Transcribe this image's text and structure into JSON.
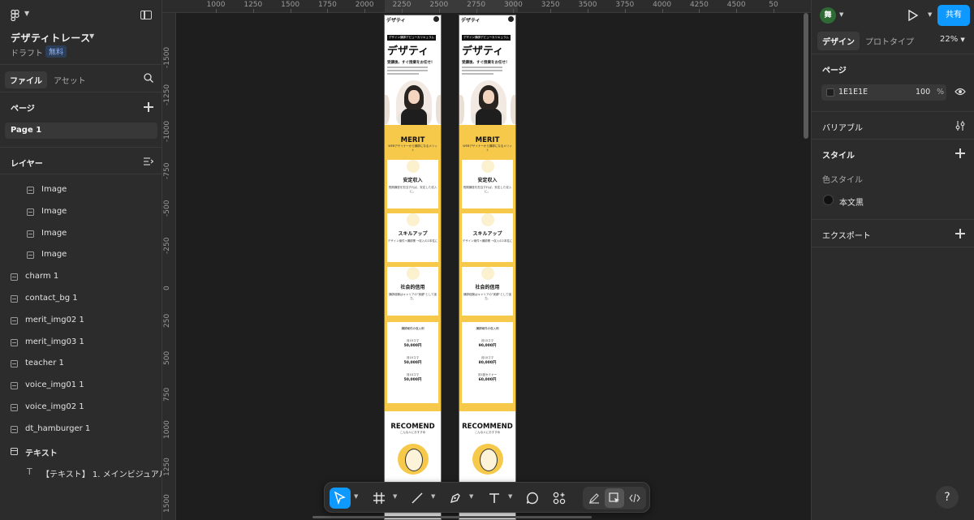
{
  "file": {
    "title": "デザティトレース",
    "draft_label": "ドラフト",
    "plan_badge": "無料"
  },
  "left_tabs": {
    "file": "ファイル",
    "assets": "アセット"
  },
  "pages": {
    "title": "ページ",
    "items": [
      "Page 1"
    ]
  },
  "layers": {
    "title": "レイヤー",
    "items": [
      {
        "name": "Image",
        "type": "image",
        "indent": 1
      },
      {
        "name": "Image",
        "type": "image",
        "indent": 1
      },
      {
        "name": "Image",
        "type": "image",
        "indent": 1
      },
      {
        "name": "Image",
        "type": "image",
        "indent": 1
      },
      {
        "name": "charm 1",
        "type": "image",
        "indent": 0
      },
      {
        "name": "contact_bg 1",
        "type": "image",
        "indent": 0
      },
      {
        "name": "merit_img02 1",
        "type": "image",
        "indent": 0
      },
      {
        "name": "merit_img03 1",
        "type": "image",
        "indent": 0
      },
      {
        "name": "teacher 1",
        "type": "image",
        "indent": 0
      },
      {
        "name": "voice_img01 1",
        "type": "image",
        "indent": 0
      },
      {
        "name": "voice_img02 1",
        "type": "image",
        "indent": 0
      },
      {
        "name": "dt_hamburger 1",
        "type": "image",
        "indent": 0
      },
      {
        "name": "テキスト",
        "type": "frame",
        "indent": 0
      },
      {
        "name": "【テキスト】 1. メインビジュアル テ",
        "type": "text",
        "indent": 1
      }
    ]
  },
  "ruler": {
    "top_labels": [
      "1000",
      "1250",
      "1500",
      "1750",
      "2000",
      "2250",
      "2500",
      "2750",
      "3000",
      "3250",
      "3500",
      "3750",
      "4000",
      "4250",
      "4500",
      "50"
    ],
    "left_labels": [
      "-1500",
      "-1250",
      "-1000",
      "-750",
      "-500",
      "-250",
      "0",
      "250",
      "500",
      "750",
      "1000",
      "1250",
      "1500"
    ]
  },
  "frames": [
    {
      "header_name": "デザティ",
      "tag": "デザイン講師デビューカリキュラム",
      "headline": "デザティ",
      "subhead": "受講後、すぐ授業をお任せ!",
      "merit_title": "MERIT",
      "merit_sub": "WEBデザイナーから講師になるメリット",
      "cards": [
        {
          "title": "安定収入",
          "desc": "長期講座を担当すれば、安定した収入に。"
        },
        {
          "title": "スキルアップ",
          "desc": "デザイン案件+講師業 →収入の2本柱に"
        },
        {
          "title": "社会的信用",
          "desc": "講師経験はキャリアの\"実績\"として強力。"
        }
      ],
      "price_title": "講師案件の収入例",
      "prices": [
        {
          "label": "月10コマ",
          "value": "50,000円"
        },
        {
          "label": "月10コマ",
          "value": "50,000円"
        },
        {
          "label": "月10コマ",
          "value": "50,000円"
        }
      ],
      "rec_title": "RECOMEND",
      "rec_sub": "こんな人におすすめ"
    },
    {
      "header_name": "デザティ",
      "tag": "デザイン講師デビューカリキュラム",
      "headline": "デザティ",
      "subhead": "受講後、すぐ授業をお任せ!",
      "merit_title": "MERIT",
      "merit_sub": "WEBデザイナーから講師になるメリット",
      "cards": [
        {
          "title": "安定収入",
          "desc": "長期講座を担当すれば、安定した収入に。"
        },
        {
          "title": "スキルアップ",
          "desc": "デザイン案件+講師業 →収入の2本柱に"
        },
        {
          "title": "社会的信用",
          "desc": "講師経験はキャリアの\"実績\"として強力。"
        }
      ],
      "price_title": "講師案件の収入例",
      "prices": [
        {
          "label": "月10コマ",
          "value": "90,000円"
        },
        {
          "label": "月10コマ",
          "value": "80,000円"
        },
        {
          "label": "月1回セミナー",
          "value": "60,000円"
        }
      ],
      "rec_title": "RECOMMEND",
      "rec_sub": "こんな人におすすめ"
    }
  ],
  "toolbar": {
    "tools": [
      "move-tool",
      "frame-tool",
      "line-tool",
      "pen-tool",
      "text-tool",
      "comment-tool",
      "actions-tool"
    ],
    "active": "move-tool",
    "modes": [
      "draw-mode",
      "design-mode",
      "dev-mode"
    ]
  },
  "right": {
    "avatar_initial": "舞",
    "share_label": "共有",
    "tabs": {
      "design": "デザイン",
      "prototype": "プロトタイプ"
    },
    "zoom": "22%",
    "page_section": {
      "title": "ページ",
      "bg_hex": "1E1E1E",
      "bg_opacity": "100",
      "bg_unit": "%"
    },
    "variables_title": "バリアブル",
    "styles": {
      "title": "スタイル",
      "sub": "色スタイル",
      "color_style_name": "本文黒"
    },
    "export_title": "エクスポート",
    "help": "?"
  },
  "colors": {
    "accent": "#0d99ff",
    "canvas_bg": "#1e1e1e",
    "panel_bg": "#2c2c2c",
    "merit_yellow": "#f7c94a"
  }
}
